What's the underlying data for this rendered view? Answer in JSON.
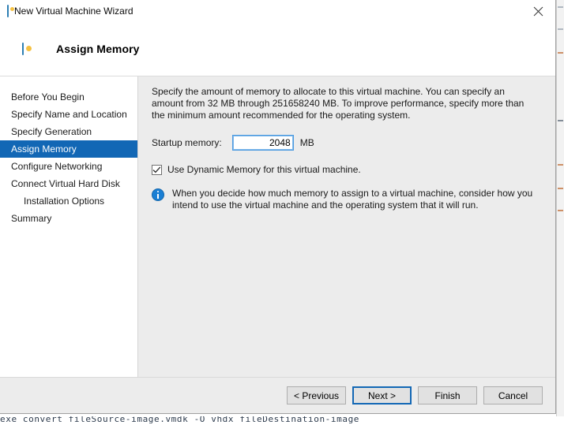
{
  "window": {
    "title": "New Virtual Machine Wizard",
    "title_icon": "virtual-machine-monitor-icon",
    "close_icon": "close-icon"
  },
  "header": {
    "icon": "virtual-machine-monitor-icon",
    "title": "Assign Memory"
  },
  "sidebar": {
    "items": [
      {
        "label": "Before You Begin",
        "selected": false,
        "indented": false
      },
      {
        "label": "Specify Name and Location",
        "selected": false,
        "indented": false
      },
      {
        "label": "Specify Generation",
        "selected": false,
        "indented": false
      },
      {
        "label": "Assign Memory",
        "selected": true,
        "indented": false
      },
      {
        "label": "Configure Networking",
        "selected": false,
        "indented": false
      },
      {
        "label": "Connect Virtual Hard Disk",
        "selected": false,
        "indented": false
      },
      {
        "label": "Installation Options",
        "selected": false,
        "indented": true
      },
      {
        "label": "Summary",
        "selected": false,
        "indented": false
      }
    ],
    "selected_background": "#1267b5",
    "selected_text_color": "#ffffff"
  },
  "main": {
    "description": "Specify the amount of memory to allocate to this virtual machine. You can specify an amount from 32 MB through 251658240 MB. To improve performance, specify more than the minimum amount recommended for the operating system.",
    "startup_memory": {
      "label": "Startup memory:",
      "value": "2048",
      "placeholder": "",
      "unit": "MB"
    },
    "dynamic_memory": {
      "label": "Use Dynamic Memory for this virtual machine.",
      "checked": true
    },
    "info_note": {
      "icon": "info-icon",
      "text": "When you decide how much memory to assign to a virtual machine, consider how you intend to use the virtual machine and the operating system that it will run."
    }
  },
  "footer": {
    "buttons": [
      {
        "label": "< Previous",
        "default": false
      },
      {
        "label": "Next >",
        "default": true
      },
      {
        "label": "Finish",
        "default": false
      },
      {
        "label": "Cancel",
        "default": false
      }
    ]
  },
  "background": {
    "console_text": "exe convert fileSource-image.vmdk -O vhdx fileDestination-image"
  },
  "colors": {
    "accent": "#1267b5",
    "dialog_background": "#ffffff",
    "pane_background": "#ececec",
    "info_blue": "#1a7fd4"
  }
}
